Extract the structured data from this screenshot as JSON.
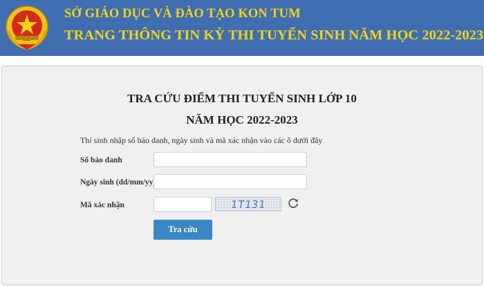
{
  "header": {
    "org": "SỞ GIÁO DỤC VÀ ĐÀO TẠO KON TUM",
    "title": "TRANG THÔNG TIN KỲ THI TUYỂN SINH NĂM HỌC 2022-2023",
    "emblem_icon": "national-emblem-icon"
  },
  "form": {
    "heading1": "TRA CỨU ĐIỂM THI TUYỂN SINH LỚP 10",
    "heading2": "NĂM HỌC 2022-2023",
    "instruction": "Thí sinh nhập số báo danh, ngày sinh và mã xác nhận vào các ô dưới đây",
    "fields": {
      "sbd": {
        "label": "Số báo danh",
        "value": "",
        "placeholder": ""
      },
      "dob": {
        "label": "Ngày sinh (dd/mm/yyyy)",
        "value": "",
        "placeholder": ""
      },
      "captcha": {
        "label": "Mã xác nhận",
        "value": "",
        "placeholder": ""
      }
    },
    "captcha_text": "1T131",
    "refresh_icon": "refresh-icon",
    "submit_label": "Tra cứu"
  },
  "colors": {
    "header_bg": "#3f6fb0",
    "header_text": "#f5d21c",
    "button_bg": "#3a87c8"
  }
}
